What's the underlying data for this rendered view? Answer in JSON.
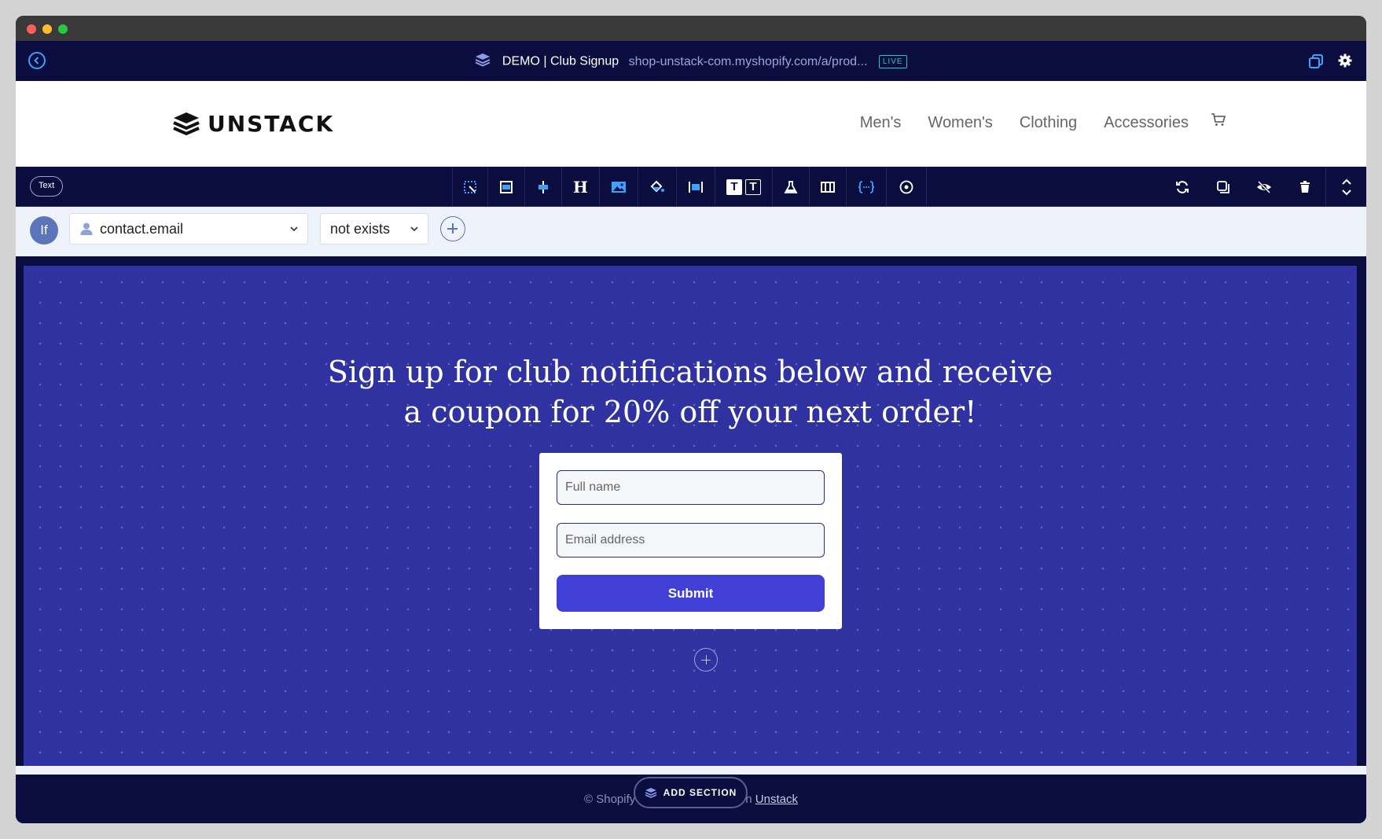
{
  "topbar": {
    "page_name": "DEMO | Club Signup",
    "page_url": "shop-unstack-com.myshopify.com/a/prod...",
    "status_badge": "LIVE"
  },
  "store": {
    "logo_text": "UNSTACK",
    "nav": [
      "Men's",
      "Women's",
      "Clothing",
      "Accessories"
    ]
  },
  "toolbar": {
    "element_type": "Text",
    "tools": [
      "select-area-icon",
      "section-layout-icon",
      "align-icon",
      "heading-icon",
      "image-icon",
      "fill-color-icon",
      "width-icon",
      "text-style-icon",
      "ab-test-icon",
      "columns-icon",
      "code-icon",
      "target-icon"
    ],
    "heading_glyph": "H",
    "text_glyph": "T"
  },
  "condition": {
    "label": "If",
    "field": "contact.email",
    "operator": "not exists"
  },
  "hero": {
    "headline_line1": "Sign up for club notifications below and receive",
    "headline_line2": "a coupon for 20% off your next order!",
    "fullname_placeholder": "Full name",
    "email_placeholder": "Email address",
    "submit_label": "Submit"
  },
  "footer": {
    "text_left": "© Shopify",
    "text_right": "h",
    "link": "Unstack",
    "add_section_label": "ADD SECTION"
  },
  "colors": {
    "navy": "#0b0d3e",
    "hero_bg": "#2f32a0",
    "submit": "#4040d6",
    "accent": "#3aa3ff",
    "live": "#2ec4b6"
  }
}
